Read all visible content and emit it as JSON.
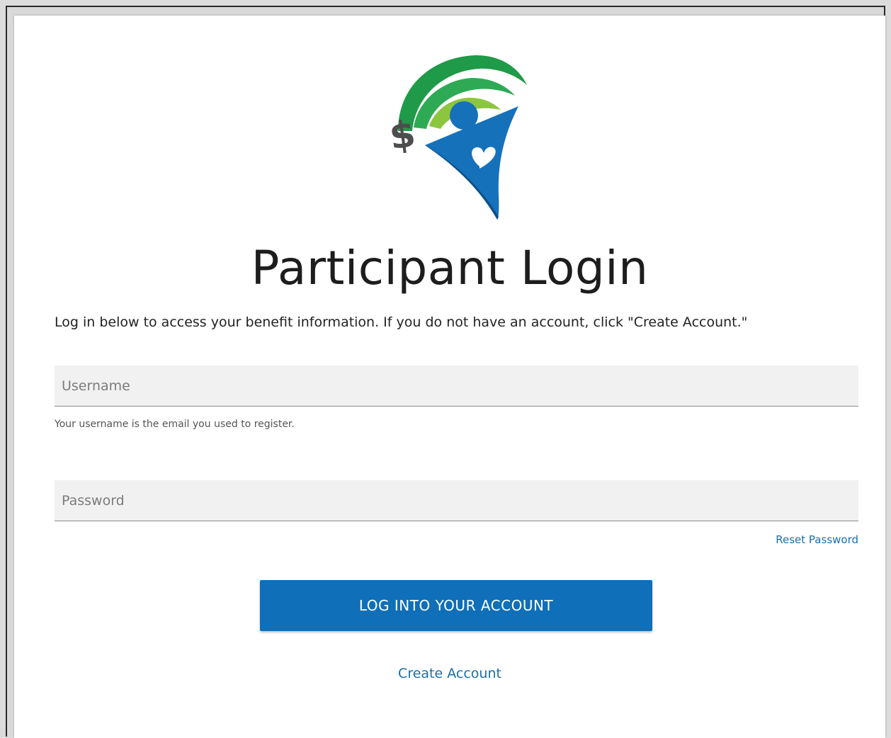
{
  "page": {
    "title": "Participant Login",
    "intro_text": "Log in below to access your benefit information. If you do not have an account, click \"Create Account.\""
  },
  "form": {
    "username_placeholder": "Username",
    "username_value": "",
    "username_hint": "Your username is the email you used to register.",
    "password_placeholder": "Password",
    "password_value": "",
    "reset_password_label": "Reset Password",
    "login_button_label": "LOG INTO YOUR ACCOUNT",
    "create_account_label": "Create Account"
  },
  "logo": {
    "icon": "benefits-logo-icon",
    "colors": {
      "green_dark": "#1f9a48",
      "green_light": "#8cc63e",
      "blue": "#1671bb",
      "gray": "#4d4d4d"
    }
  },
  "colors": {
    "accent": "#0f6fb8",
    "link": "#1a6fa8",
    "field_bg": "#f1f1f1"
  }
}
